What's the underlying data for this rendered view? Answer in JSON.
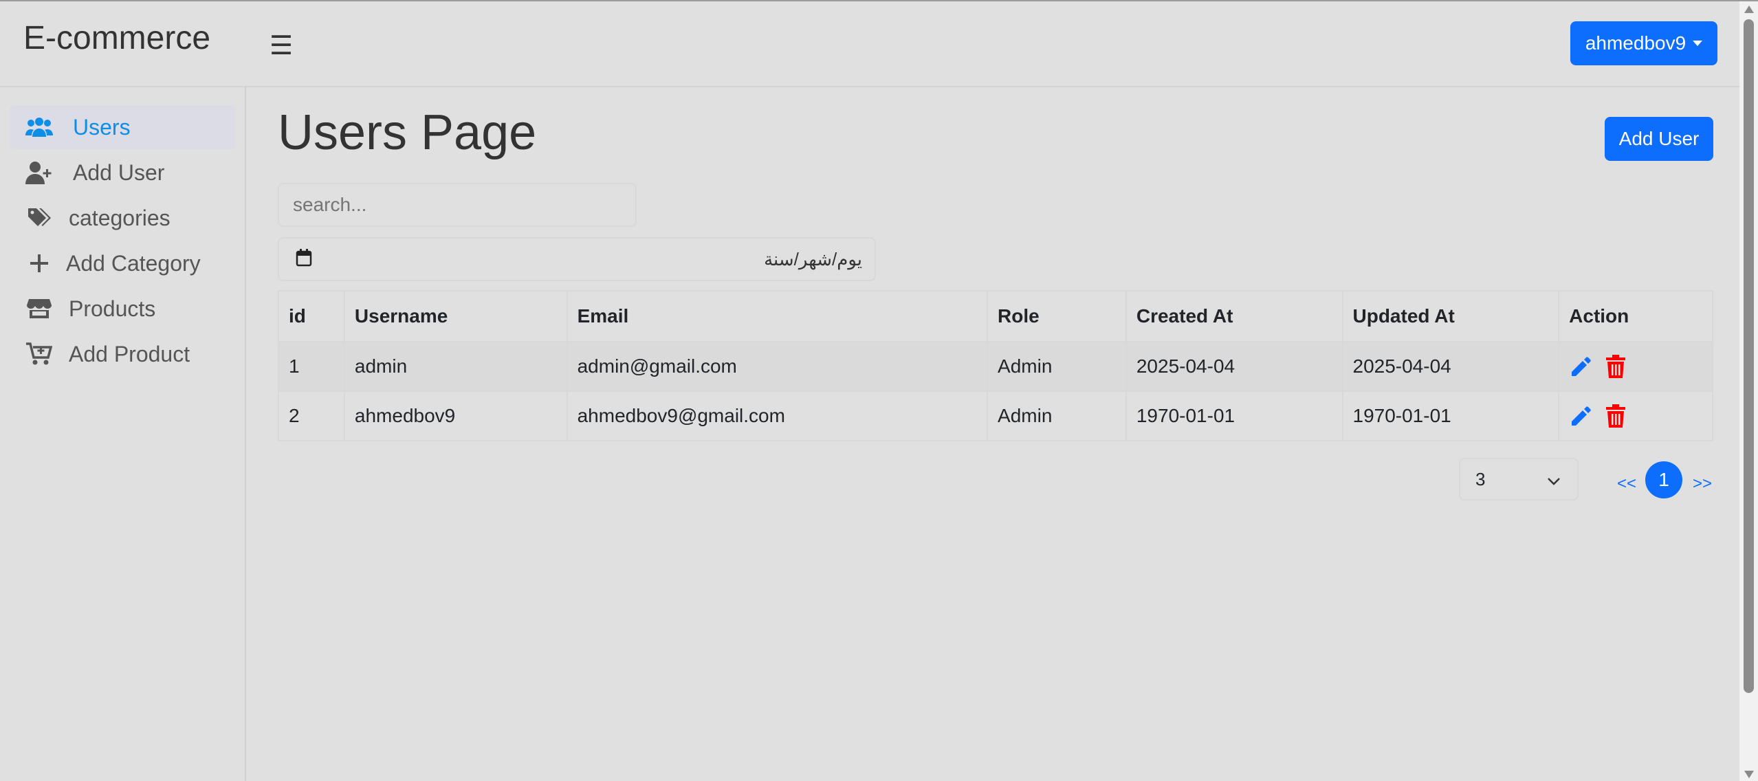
{
  "header": {
    "brand": "E-commerce",
    "menu_icon": "hamburger-icon",
    "user_menu_label": "ahmedbov9"
  },
  "sidebar": {
    "items": [
      {
        "label": "Users",
        "icon": "users-icon",
        "active": true
      },
      {
        "label": "Add User",
        "icon": "user-plus-icon"
      },
      {
        "label": "categories",
        "icon": "tags-icon"
      },
      {
        "label": "Add Category",
        "icon": "plus-icon"
      },
      {
        "label": "Products",
        "icon": "store-icon"
      },
      {
        "label": "Add Product",
        "icon": "cart-plus-icon"
      }
    ]
  },
  "main": {
    "title": "Users Page",
    "add_button": "Add User",
    "search": {
      "placeholder": "search...",
      "value": ""
    },
    "date_filter": {
      "placeholder": "يوم/شهر/سنة",
      "icon": "calendar-icon"
    },
    "table": {
      "headers": [
        "id",
        "Username",
        "Email",
        "Role",
        "Created At",
        "Updated At",
        "Action"
      ],
      "rows": [
        {
          "id": "1",
          "username": "admin",
          "email": "admin@gmail.com",
          "role": "Admin",
          "created": "2025-04-04",
          "updated": "2025-04-04"
        },
        {
          "id": "2",
          "username": "ahmedbov9",
          "email": "ahmedbov9@gmail.com",
          "role": "Admin",
          "created": "1970-01-01",
          "updated": "1970-01-01"
        }
      ],
      "actions": [
        "edit-icon",
        "delete-icon"
      ]
    },
    "pagination": {
      "per_page": "3",
      "prev": "<<",
      "current": "1",
      "next": ">>"
    }
  },
  "colors": {
    "primary": "#0d6efd",
    "active_link": "#0d8ee8",
    "delete": "#ff0000"
  }
}
